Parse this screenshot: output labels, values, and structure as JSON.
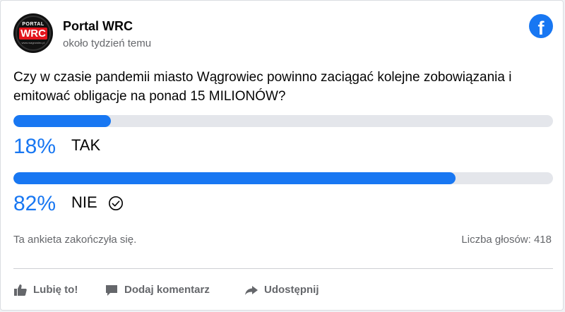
{
  "post": {
    "page_name": "Portal WRC",
    "time": "około tydzień temu",
    "avatar_top": "PORTAL",
    "avatar_logo": "WRC",
    "avatar_sub": "www.wagrowiec.pl"
  },
  "poll": {
    "question": "Czy w czasie pandemii miasto Wągrowiec powinno zaciągać kolejne zobowiązania i emitować obligacje na ponad 15 MILIONÓW?",
    "options": [
      {
        "percent_label": "18%",
        "percent": 18,
        "label": "TAK",
        "chosen": false
      },
      {
        "percent_label": "82%",
        "percent": 82,
        "label": "NIE",
        "chosen": true
      }
    ],
    "status": "Ta ankieta zakończyła się.",
    "votes_label": "Liczba głosów: 418"
  },
  "actions": {
    "like": "Lubię to!",
    "comment": "Dodaj komentarz",
    "share": "Udostępnij"
  },
  "icons": {
    "brand": "facebook-icon",
    "chosen": "check-circle-icon",
    "like": "thumbs-up-icon",
    "comment": "comment-icon",
    "share": "share-arrow-icon"
  },
  "colors": {
    "accent": "#1877f2",
    "track": "#e4e6eb",
    "muted_text": "#65676b",
    "logo_red": "#e3141c"
  }
}
